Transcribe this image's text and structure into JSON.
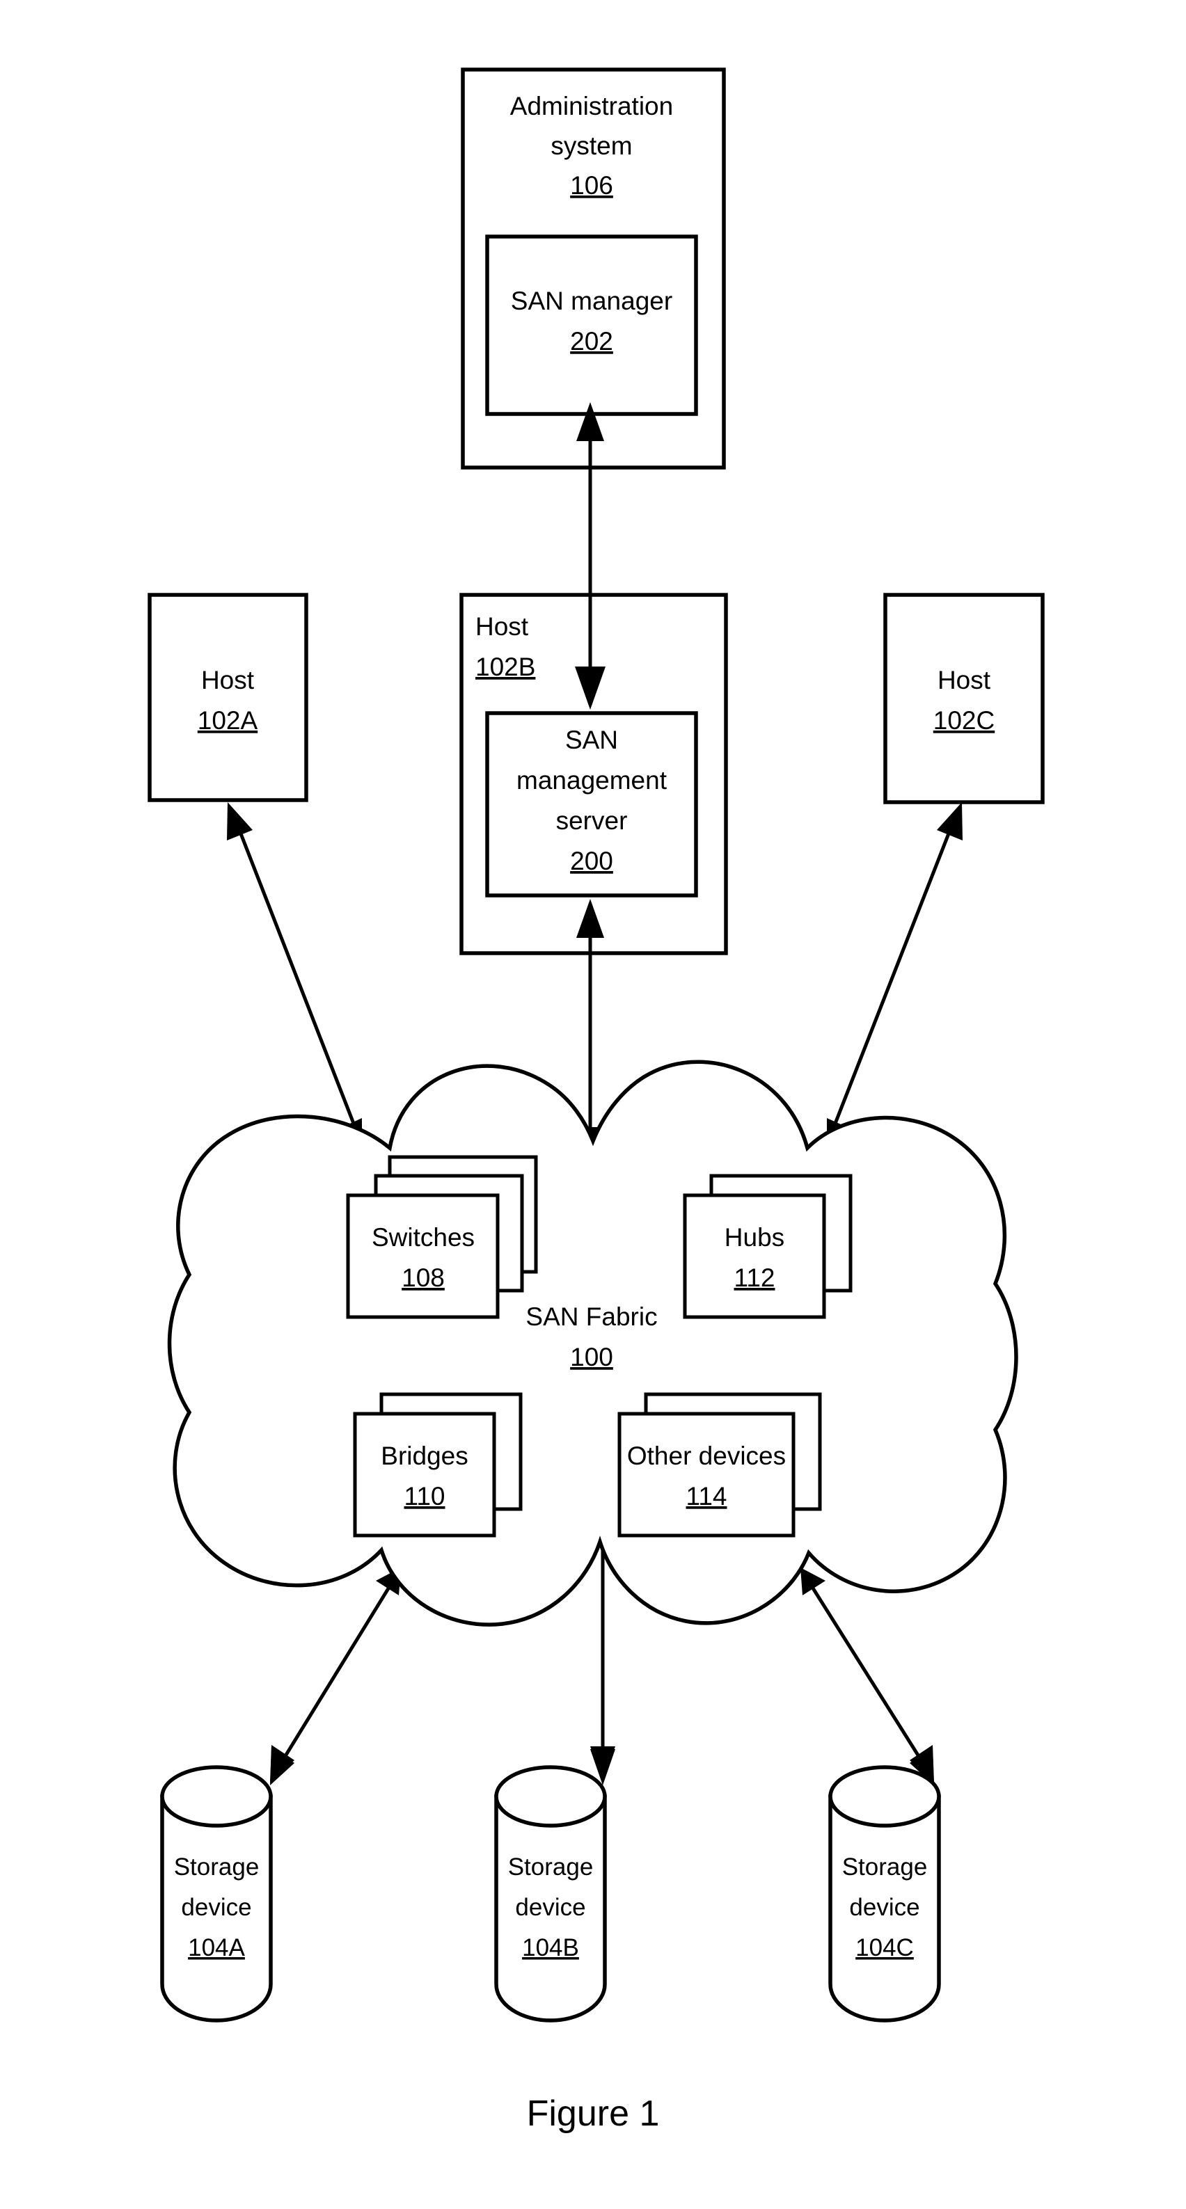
{
  "figure": {
    "caption": "Figure 1"
  },
  "nodes": {
    "administration_system": {
      "label_line1": "Administration",
      "label_line2": "system",
      "ref": "106"
    },
    "san_manager": {
      "label_line1": "SAN manager",
      "ref": "202"
    },
    "host_a": {
      "label_line1": "Host",
      "ref": "102A"
    },
    "host_b": {
      "label_line1": "Host",
      "ref": "102B"
    },
    "host_c": {
      "label_line1": "Host",
      "ref": "102C"
    },
    "san_management_server": {
      "label_line1": "SAN",
      "label_line2": "management",
      "label_line3": "server",
      "ref": "200"
    },
    "san_fabric": {
      "label_line1": "SAN Fabric",
      "ref": "100"
    },
    "switches": {
      "label_line1": "Switches",
      "ref": "108"
    },
    "hubs": {
      "label_line1": "Hubs",
      "ref": "112"
    },
    "bridges": {
      "label_line1": "Bridges",
      "ref": "110"
    },
    "other_devices": {
      "label_line1": "Other devices",
      "ref": "114"
    },
    "storage_a": {
      "label_line1": "Storage",
      "label_line2": "device",
      "ref": "104A"
    },
    "storage_b": {
      "label_line1": "Storage",
      "label_line2": "device",
      "ref": "104B"
    },
    "storage_c": {
      "label_line1": "Storage",
      "label_line2": "device",
      "ref": "104C"
    }
  },
  "connections": [
    {
      "id": "admin-to-host-b",
      "from": "san_manager",
      "to": "san_management_server",
      "style": "double-arrow"
    },
    {
      "id": "host-b-to-fabric",
      "from": "san_management_server",
      "to": "san_fabric",
      "style": "double-arrow"
    },
    {
      "id": "host-a-to-fabric",
      "from": "host_a",
      "to": "san_fabric",
      "style": "double-arrow"
    },
    {
      "id": "host-c-to-fabric",
      "from": "host_c",
      "to": "san_fabric",
      "style": "double-arrow"
    },
    {
      "id": "fabric-to-storage-a",
      "from": "san_fabric",
      "to": "storage_a",
      "style": "double-arrow"
    },
    {
      "id": "fabric-to-storage-b",
      "from": "san_fabric",
      "to": "storage_b",
      "style": "double-arrow"
    },
    {
      "id": "fabric-to-storage-c",
      "from": "san_fabric",
      "to": "storage_c",
      "style": "double-arrow"
    }
  ],
  "colors": {
    "ink": "#000000",
    "paper": "#ffffff"
  }
}
